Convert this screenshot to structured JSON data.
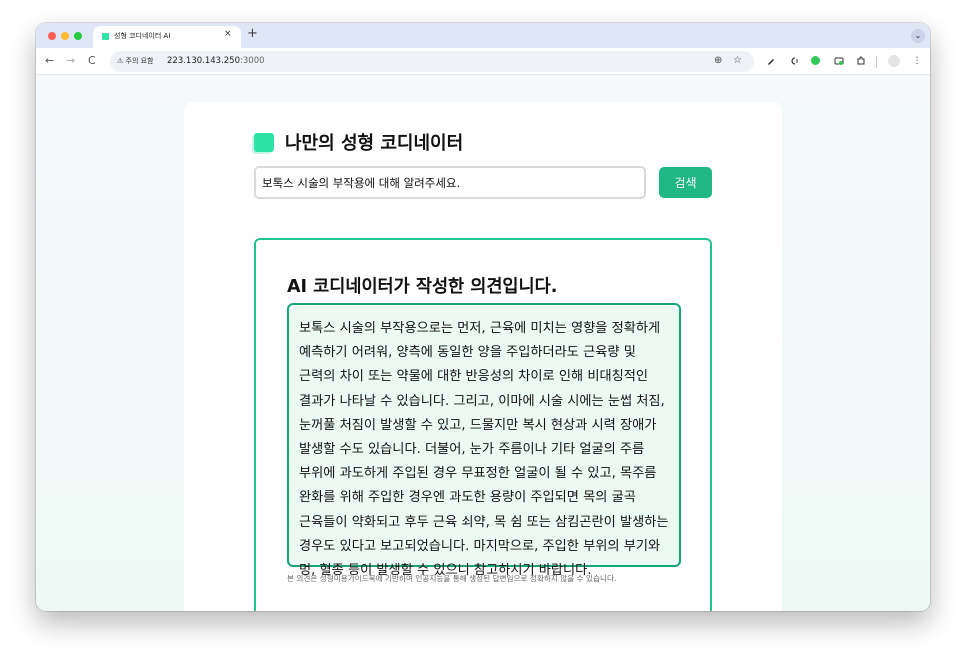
{
  "browser": {
    "tab_title": "성형 코디네이터 AI",
    "tab_close": "×",
    "new_tab": "+",
    "tab_dropdown": "⌄",
    "nav_back": "←",
    "nav_forward": "→",
    "nav_reload": "C",
    "security_label": "⚠ 주의 요함",
    "url_host": "223.130.143.250",
    "url_port": ":3000",
    "zoom_icon": "⊕",
    "star_icon": "☆",
    "menu_icon": "⋮"
  },
  "app": {
    "title": "나만의 성형 코디네이터",
    "accent_color": "#2ee3a6",
    "button_color": "#1fb884"
  },
  "search": {
    "value": "보톡스 시술의 부작용에 대해 알려주세요.",
    "button_label": "검색"
  },
  "result": {
    "heading": "AI 코디네이터가 작성한 의견입니다.",
    "answer": "보톡스 시술의 부작용으로는 먼저, 근육에 미치는 영향을 정확하게 예측하기 어려워, 양측에 동일한 양을 주입하더라도 근육량 및 근력의 차이 또는 약물에 대한 반응성의 차이로 인해 비대칭적인 결과가 나타날 수 있습니다. 그리고, 이마에 시술 시에는 눈썹 처짐, 눈꺼풀 처짐이 발생할 수 있고, 드물지만 복시 현상과 시력 장애가 발생할 수도 있습니다. 더불어, 눈가 주름이나 기타 얼굴의 주름 부위에 과도하게 주입된 경우 무표정한 얼굴이 될 수 있고, 목주름 완화를 위해 주입한 경우엔 과도한 용량이 주입되면 목의 굴곡 근육들이 약화되고 후두 근육 쇠약, 목 쉼 또는 삼킴곤란이 발생하는 경우도 있다고 보고되었습니다. 마지막으로, 주입한 부위의 부기와 멍, 혈종 등이 발생할 수 있으니 참고하시기 바랍니다.",
    "disclaimer": "본 의견은 성형미용가이드북에 기반하여 인공지능을 통해 생성된 답변임으로 정확하지 않을 수 있습니다."
  }
}
